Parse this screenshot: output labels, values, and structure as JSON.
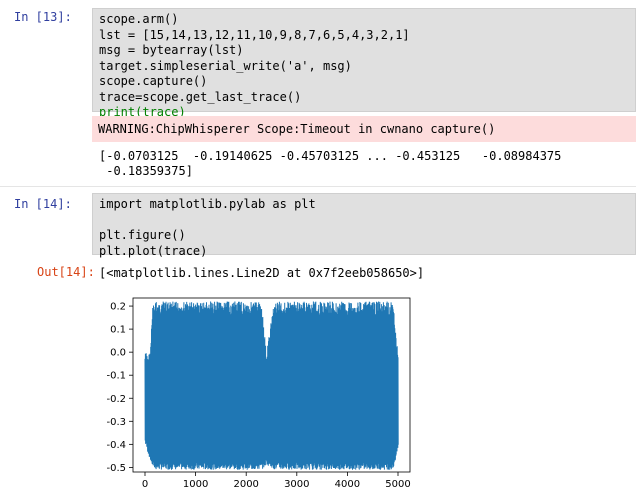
{
  "cell13": {
    "prompt": "In [13]:",
    "code": [
      "scope.arm()",
      "lst = [15,14,13,12,11,10,9,8,7,6,5,4,3,2,1]",
      "msg = bytearray(lst)",
      "target.simpleserial_write('a', msg)",
      "scope.capture()",
      "trace=scope.get_last_trace()",
      "print(trace)"
    ],
    "warning": "WARNING:ChipWhisperer Scope:Timeout in cwnano capture()",
    "output_line1": "[-0.0703125  -0.19140625 -0.45703125 ... -0.453125   -0.08984375",
    "output_line2": " -0.18359375]"
  },
  "cell14": {
    "prompt": "In [14]:",
    "code": [
      "import matplotlib.pylab as plt",
      "",
      "plt.figure()",
      "plt.plot(trace)"
    ],
    "out_prompt": "Out[14]:",
    "output": "[<matplotlib.lines.Line2D at 0x7f2eeb058650>]"
  },
  "colors": {
    "prompt_in": "#303f9f",
    "prompt_out": "#d84315",
    "code_bg": "#e0e0e0",
    "warning_bg": "#fddcdc",
    "line": "#1f77b4"
  },
  "chart_data": {
    "type": "line",
    "title": "",
    "xlabel": "",
    "ylabel": "",
    "xlim": [
      0,
      5000
    ],
    "ylim": [
      -0.5,
      0.2
    ],
    "xticks": [
      "0",
      "1000",
      "2000",
      "3000",
      "4000",
      "5000"
    ],
    "yticks": [
      "0.2",
      "0.1",
      "0.0",
      "-0.1",
      "-0.2",
      "-0.3",
      "-0.4",
      "-0.5"
    ],
    "series": [
      {
        "x": [
          0,
          100,
          150,
          200,
          1200,
          2300,
          2400,
          2500,
          2550,
          2700,
          3000,
          4000,
          4500,
          4900,
          5000
        ],
        "upper": [
          0.0,
          0.0,
          0.2,
          0.22,
          0.22,
          0.22,
          0.0,
          0.15,
          0.22,
          0.22,
          0.22,
          0.22,
          0.22,
          0.22,
          0.0
        ],
        "lower": [
          -0.4,
          -0.47,
          -0.5,
          -0.51,
          -0.51,
          -0.51,
          -0.49,
          -0.5,
          -0.51,
          -0.51,
          -0.51,
          -0.51,
          -0.51,
          -0.51,
          -0.42
        ]
      }
    ],
    "grid": false
  }
}
